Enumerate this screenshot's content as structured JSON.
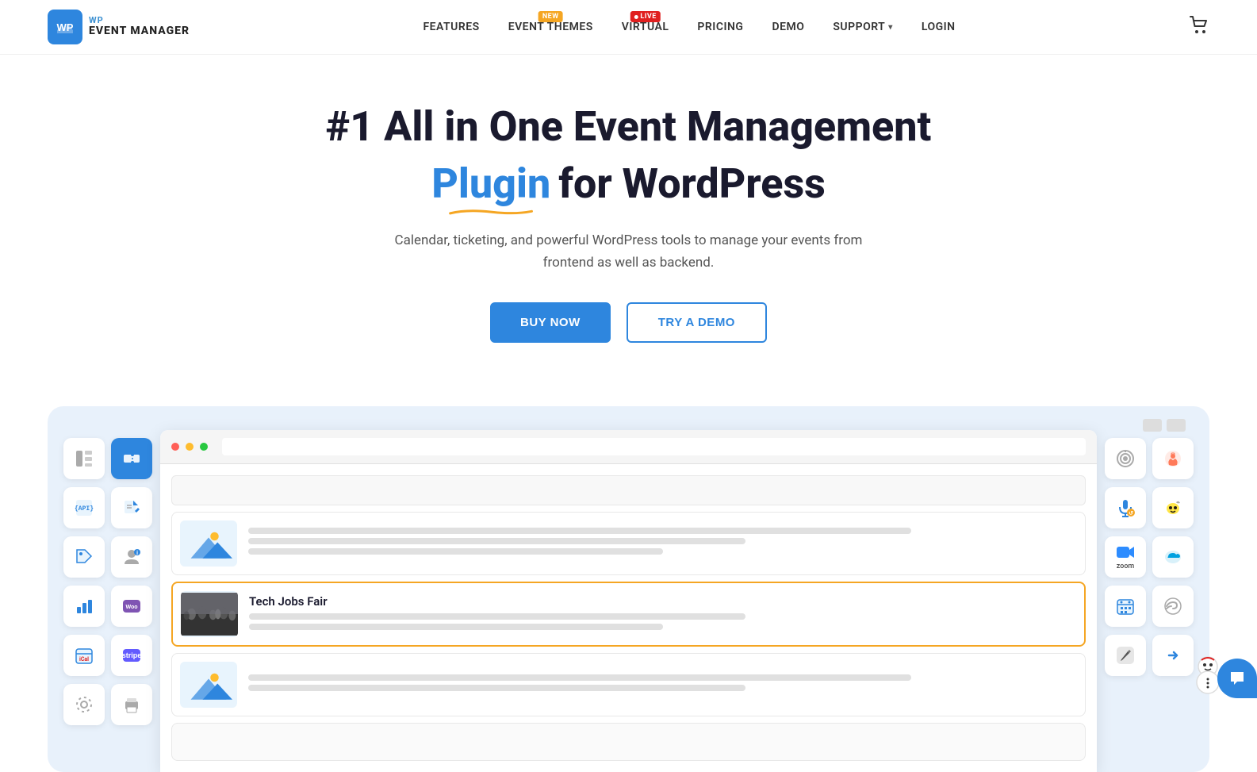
{
  "header": {
    "logo_wp": "WP",
    "logo_event_manager": "EVENT MANAGER",
    "nav": [
      {
        "id": "features",
        "label": "FEATURES",
        "badge": null
      },
      {
        "id": "event-themes",
        "label": "EVENT THEMES",
        "badge": "NEW"
      },
      {
        "id": "virtual",
        "label": "VIRTUAL",
        "badge": "LIVE"
      },
      {
        "id": "pricing",
        "label": "PRICING",
        "badge": null
      },
      {
        "id": "demo",
        "label": "DEMO",
        "badge": null
      },
      {
        "id": "support",
        "label": "SUPPORT",
        "badge": null,
        "dropdown": true
      },
      {
        "id": "login",
        "label": "LOGIN",
        "badge": null
      }
    ]
  },
  "hero": {
    "headline_part1": "#1 All in One Event Management",
    "headline_plugin": "Plugin",
    "headline_part2": " for WordPress",
    "subtitle": "Calendar, ticketing, and powerful WordPress tools to manage your events from frontend as well as backend.",
    "btn_buy": "BUY NOW",
    "btn_demo": "TRY A DEMO"
  },
  "preview": {
    "event_card_title": "Tech Jobs Fair",
    "browser_dots": [
      "red",
      "yellow",
      "green"
    ]
  },
  "icons": {
    "left": [
      [
        "elementor",
        "ticket"
      ],
      [
        "api",
        "edit"
      ],
      [
        "tag",
        "user"
      ],
      [
        "chart",
        "woo"
      ],
      [
        "ical",
        "stripe"
      ],
      [
        "settings",
        "print"
      ]
    ],
    "right_col1": [
      "broadcast",
      "mic",
      "zoom",
      "calendar",
      "pencil"
    ],
    "right_col2": [
      "hubspot",
      "mailchimp",
      "salesforce",
      "wind",
      "arrow"
    ]
  },
  "colors": {
    "primary": "#2e86de",
    "accent": "#f5a623",
    "danger": "#e02020",
    "dark": "#1a1a2e",
    "light_bg": "#e8f1fb"
  }
}
